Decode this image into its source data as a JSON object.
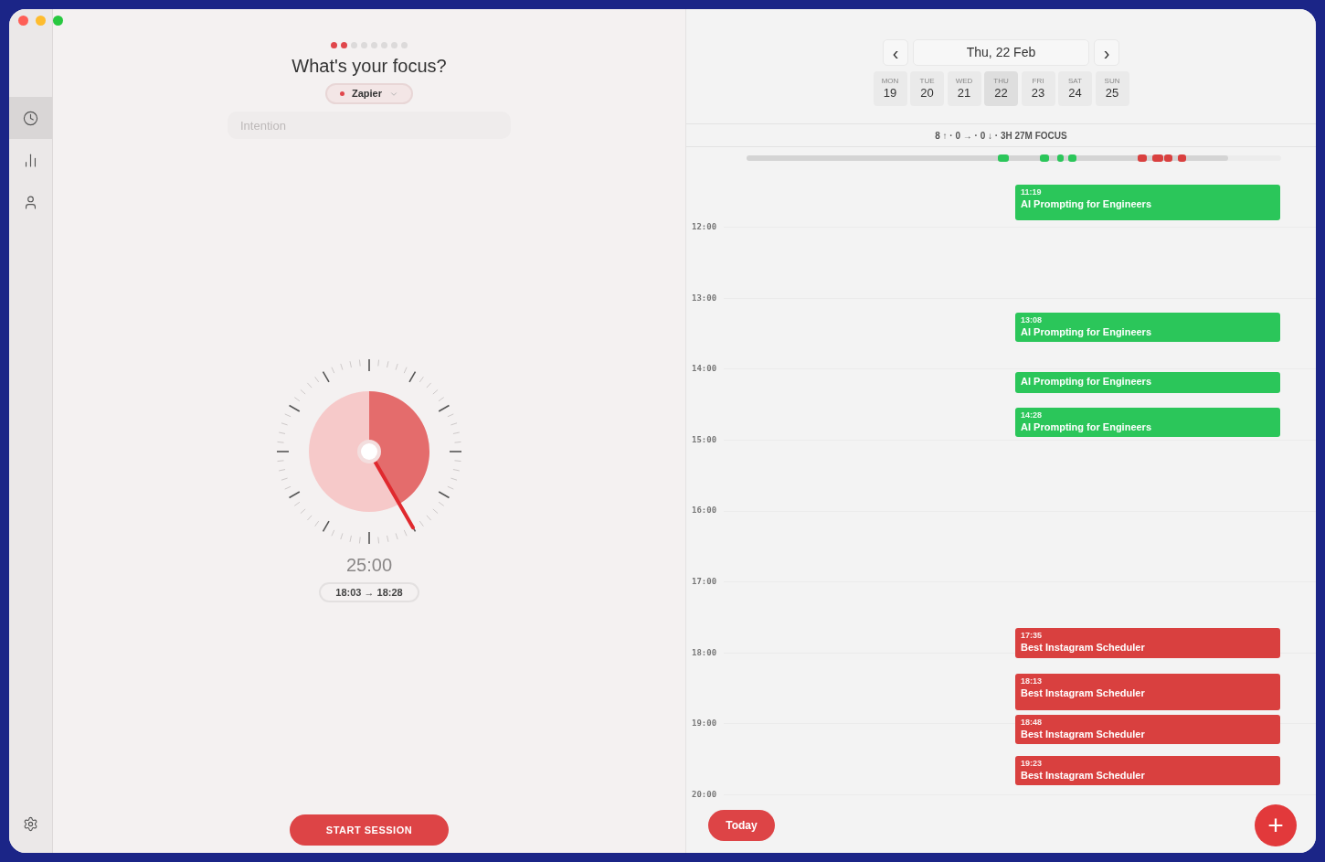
{
  "sidebar": {
    "items": [
      {
        "selected": true
      },
      {
        "selected": false
      },
      {
        "selected": false
      }
    ]
  },
  "focus": {
    "steps": [
      {
        "done": true
      },
      {
        "done": true
      },
      {
        "done": false
      },
      {
        "done": false
      },
      {
        "done": false
      },
      {
        "done": false
      },
      {
        "done": false
      },
      {
        "done": false
      }
    ],
    "title": "What's your focus?",
    "project": {
      "label": "Zapier",
      "color": "#e0474c"
    },
    "intention": {
      "placeholder": "Intention"
    },
    "duration": "25:00",
    "range": "18:03 → 18:28",
    "start_button": "START SESSION"
  },
  "calendar": {
    "prev": "‹",
    "date": "Thu, 22 Feb",
    "next": "›",
    "days": [
      {
        "weekday": "MON",
        "day": "19",
        "selected": false
      },
      {
        "weekday": "TUE",
        "day": "20",
        "selected": false
      },
      {
        "weekday": "WED",
        "day": "21",
        "selected": false
      },
      {
        "weekday": "THU",
        "day": "22",
        "selected": true
      },
      {
        "weekday": "FRI",
        "day": "23",
        "selected": false
      },
      {
        "weekday": "SAT",
        "day": "24",
        "selected": false
      },
      {
        "weekday": "SUN",
        "day": "25",
        "selected": false
      }
    ],
    "summary": "8 ↑ · 0 → · 0 ↓ · 3H 27M FOCUS",
    "hours": [
      "12:00",
      "13:00",
      "14:00",
      "15:00",
      "16:00",
      "17:00",
      "18:00",
      "19:00",
      "20:00"
    ],
    "events": [
      {
        "time": "11:19",
        "title": "AI Prompting for Engineers",
        "color": "#2bc65a"
      },
      {
        "time": "13:08",
        "title": "AI Prompting for Engineers",
        "color": "#2bc65a"
      },
      {
        "title": "AI Prompting for Engineers",
        "color": "#2bc65a"
      },
      {
        "time": "14:28",
        "title": "AI Prompting for Engineers",
        "color": "#2bc65a"
      },
      {
        "time": "17:35",
        "title": "Best Instagram Scheduler",
        "color": "#d9403f"
      },
      {
        "time": "18:13",
        "title": "Best Instagram Scheduler",
        "color": "#d9403f"
      },
      {
        "time": "18:48",
        "title": "Best Instagram Scheduler",
        "color": "#d9403f"
      },
      {
        "time": "19:23",
        "title": "Best Instagram Scheduler",
        "color": "#d9403f"
      }
    ],
    "today_button": "Today",
    "add_button": "+"
  }
}
